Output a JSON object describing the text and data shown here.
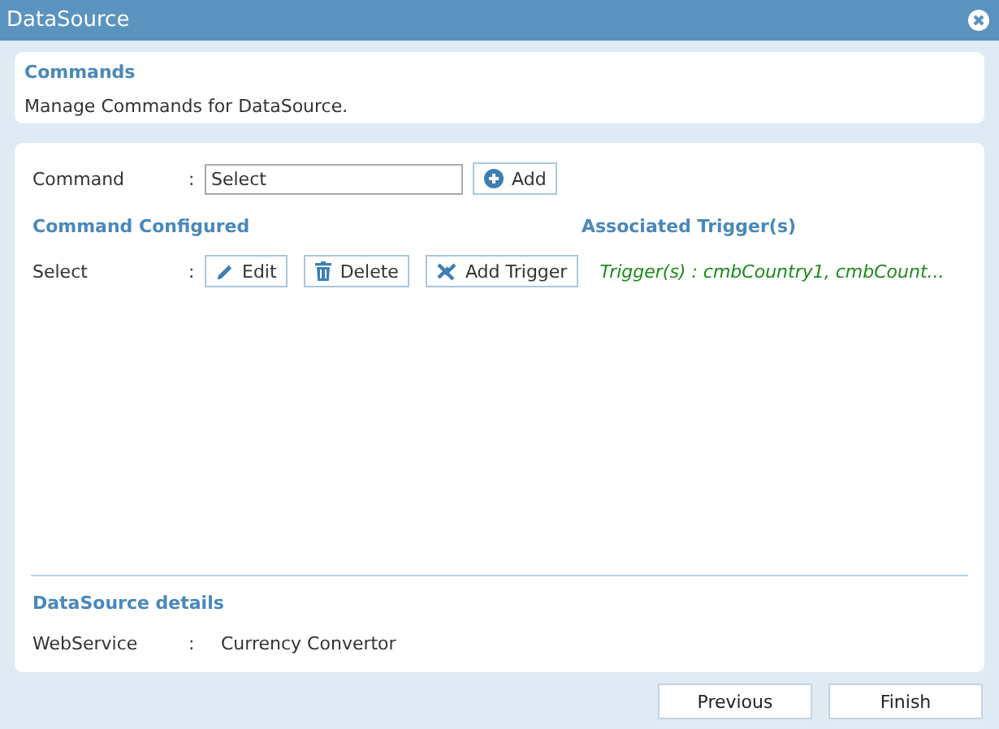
{
  "window": {
    "title": "DataSource"
  },
  "header": {
    "title": "Commands",
    "description": "Manage Commands for DataSource."
  },
  "command_field": {
    "label": "Command",
    "separator": ":",
    "value": "Select",
    "add_button": "Add"
  },
  "configured": {
    "heading": "Command Configured",
    "triggers_heading": "Associated Trigger(s)",
    "rows": [
      {
        "name": "Select",
        "separator": ":",
        "edit": "Edit",
        "delete": "Delete",
        "add_trigger": "Add Trigger",
        "triggers": "Trigger(s) : cmbCountry1, cmbCount..."
      }
    ]
  },
  "details": {
    "heading": "DataSource details",
    "rows": [
      {
        "label": "WebService",
        "separator": ":",
        "value": "Currency Convertor"
      }
    ]
  },
  "buttons": [
    "Previous",
    "Finish"
  ]
}
